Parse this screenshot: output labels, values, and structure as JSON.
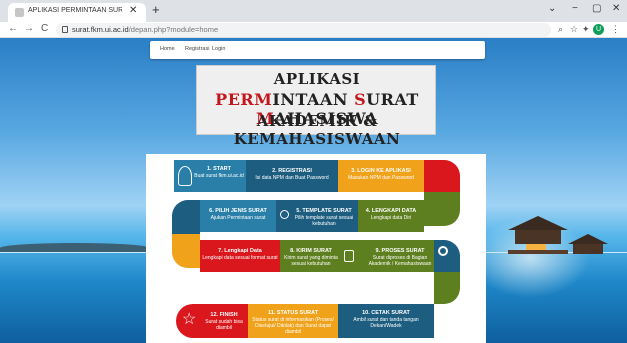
{
  "browser": {
    "tab_title": "APLIKASI PERMINTAAN SURAT M",
    "url_host": "surat.fkm.ui.ac.id",
    "url_path": "/depan.php?module=home",
    "profile_initial": "U",
    "new_tab": "+",
    "close": "✕",
    "window": {
      "chevron": "⌄",
      "minimize": "−",
      "restore": "▢",
      "close": "✕"
    },
    "nav": {
      "back": "←",
      "forward": "→",
      "reload": "C"
    },
    "tools": {
      "search": "⌕",
      "star": "☆",
      "extensions": "✦",
      "menu": "⋮"
    }
  },
  "site_nav": {
    "items": [
      "Home",
      "Registrasi",
      "Login"
    ]
  },
  "title": {
    "line1": "APLIKASI",
    "line2_parts": [
      {
        "text": "PERM",
        "color": "red"
      },
      {
        "text": "INTAAN ",
        "color": "dark"
      },
      {
        "text": "S",
        "color": "red"
      },
      {
        "text": "URAT ",
        "color": "dark"
      },
      {
        "text": "M",
        "color": "red"
      },
      {
        "text": "AHASISWA",
        "color": "dark"
      }
    ],
    "line3": "AKADEMIK & KEMAHASISWAAN"
  },
  "steps": [
    {
      "title": "1. START",
      "desc": "Buat surat fkm.ui.ac.id",
      "color": "#2a7fa8"
    },
    {
      "title": "2. REGISTRASI",
      "desc": "Isi data NPM dan Buat Password",
      "color": "#1d5d80"
    },
    {
      "title": "3. LOGIN KE APLIKASI",
      "desc": "Masukan NPM dan Password",
      "color": "#f0a21a"
    },
    {
      "title": "4. LENGKAPI DATA",
      "desc": "Lengkapi data Diri",
      "color": "#5e7f1f"
    },
    {
      "title": "5. TEMPLATE SURAT",
      "desc": "Pilih template surat sesuai kebutuhan",
      "color": "#1d5d80"
    },
    {
      "title": "6. PILIH JENIS SURAT",
      "desc": "Ajukan Permintaan surat",
      "color": "#2a7fa8"
    },
    {
      "title": "7. Lengkapi Data",
      "desc": "Lengkapi data sesuai format surat",
      "color": "#d9171d"
    },
    {
      "title": "8. KIRIM SURAT",
      "desc": "Kirim surat yang diminta sesuai kebutuhan",
      "color": "#5e7f1f"
    },
    {
      "title": "9. PROSES SURAT",
      "desc": "Surat diproses di Bagian Akademik / Kemahasiswaan",
      "color": "#5e7f1f"
    },
    {
      "title": "10. CETAK SURAT",
      "desc": "Ambil surat dan tanda tangan Dekan/Wadek",
      "color": "#1d5d80"
    },
    {
      "title": "11. STATUS SURAT",
      "desc": "Status surat di informasikan (Proses/ Disetujui/ Ditolak) dan Surat dapat diambil",
      "color": "#f0a21a"
    },
    {
      "title": "12. FINISH",
      "desc": "Surat sudah bisa diambil",
      "color": "#d9171d"
    }
  ]
}
